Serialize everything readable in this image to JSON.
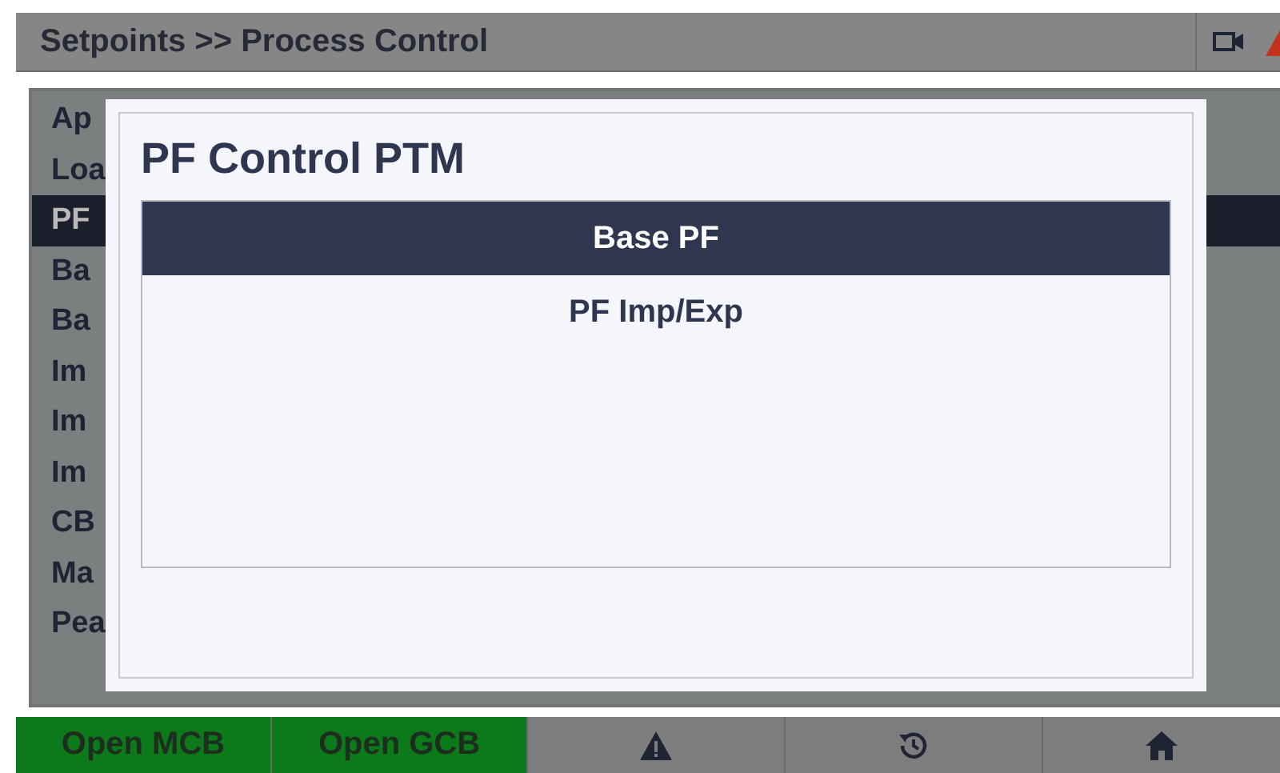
{
  "header": {
    "title": "Setpoints >> Process Control"
  },
  "list": [
    {
      "label": "Ap",
      "selected": false
    },
    {
      "label": "Loa",
      "selected": false
    },
    {
      "label": "PF",
      "selected": true
    },
    {
      "label": "Ba",
      "selected": false
    },
    {
      "label": "Ba",
      "selected": false
    },
    {
      "label": "Im",
      "selected": false
    },
    {
      "label": "Im",
      "selected": false
    },
    {
      "label": "Im",
      "selected": false
    },
    {
      "label": "CB",
      "selected": false
    },
    {
      "label": "Ma",
      "selected": false
    },
    {
      "label": "Pea",
      "selected": false
    }
  ],
  "dialog": {
    "title": "PF Control PTM",
    "options": [
      {
        "label": "Base PF",
        "selected": true
      },
      {
        "label": "PF Imp/Exp",
        "selected": false
      }
    ]
  },
  "footer": [
    {
      "kind": "text",
      "label": "Open MCB"
    },
    {
      "kind": "text",
      "label": "Open GCB"
    },
    {
      "kind": "warning"
    },
    {
      "kind": "history"
    },
    {
      "kind": "home"
    }
  ]
}
